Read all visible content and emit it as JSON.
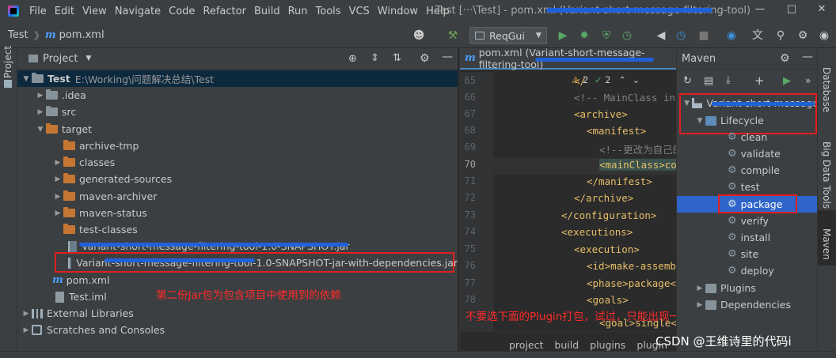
{
  "menu": {
    "items": [
      "File",
      "Edit",
      "View",
      "Navigate",
      "Code",
      "Refactor",
      "Build",
      "Run",
      "Tools",
      "VCS",
      "Window",
      "Help"
    ],
    "window_title": "Test [···\\Test] - pom.xml (Variant-short-message-filtering-tool)"
  },
  "navbar": {
    "breadcrumb_root": "Test",
    "breadcrumb_file": "pom.xml",
    "run_config": "ReqGui"
  },
  "left_stripe": {
    "project_label": "Project"
  },
  "right_stripe": {
    "database": "Database",
    "bigdata": "Big Data Tools",
    "maven": "Maven"
  },
  "project_panel": {
    "title": "Project",
    "tree": [
      {
        "label": "Test",
        "path": "E:\\Working\\问题解决总结\\Test"
      },
      {
        "label": ".idea"
      },
      {
        "label": "src"
      },
      {
        "label": "target"
      },
      {
        "label": "archive-tmp"
      },
      {
        "label": "classes"
      },
      {
        "label": "generated-sources"
      },
      {
        "label": "maven-archiver"
      },
      {
        "label": "maven-status"
      },
      {
        "label": "test-classes"
      },
      {
        "label": "Variant-short-message-filtering-tool-1.0-SNAPSHOT.jar"
      },
      {
        "label": "Variant-short-message-filtering-tool-1.0-SNAPSHOT-jar-with-dependencies.jar"
      },
      {
        "label": "pom.xml"
      },
      {
        "label": "Test.iml"
      },
      {
        "label": "External Libraries"
      },
      {
        "label": "Scratches and Consoles"
      }
    ],
    "note": "第二份Jar包为包含项目中使用到的依赖"
  },
  "editor": {
    "tab_label": "pom.xml (Variant-short-message-filtering-tool)",
    "inspections": {
      "warnings": "2",
      "ok": "2"
    },
    "line_numbers": [
      "65",
      "66",
      "67",
      "68",
      "69",
      "70",
      "71",
      "72",
      "73",
      "74",
      "75",
      "76",
      "77",
      "78"
    ],
    "lines": [
      "</",
      "<!-- MainClass in",
      "<archive>",
      "<manifest>",
      "<!--更改为自己的",
      "<mainClass>co",
      "</manifest>",
      "</archive>",
      "</configuration>",
      "<executions>",
      "<execution>",
      "<id>make-assemb",
      "<phase>package<",
      "<goals>",
      "<goal>single<"
    ],
    "breadcrumb": [
      "project",
      "build",
      "plugins",
      "plugin"
    ],
    "note": "不要选下面的Plugin打包，试过，只能出现一份!生成的jar包"
  },
  "maven": {
    "title": "Maven",
    "project": "Variant-short-message-f",
    "lifecycle": "Lifecycle",
    "phases": [
      "clean",
      "validate",
      "compile",
      "test",
      "package",
      "verify",
      "install",
      "site",
      "deploy"
    ],
    "plugins": "Plugins",
    "dependencies": "Dependencies"
  },
  "watermark": "CSDN @王维诗里的代码i",
  "colors": {
    "accent": "#2f65ca",
    "annotation_red": "#e02020",
    "scribble_blue": "#1f62d8"
  }
}
